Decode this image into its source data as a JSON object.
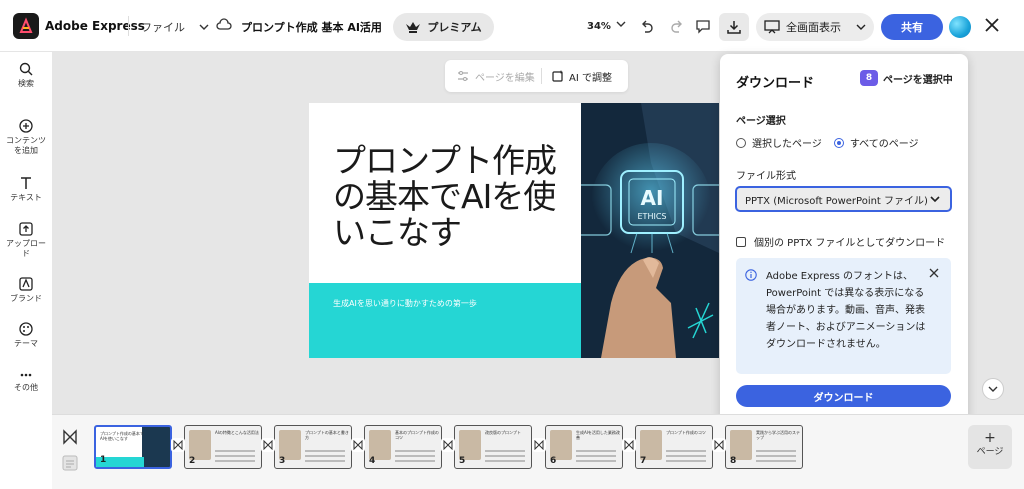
{
  "header": {
    "app_name": "Adobe Express",
    "file_menu": "ファイル",
    "doc_title": "プロンプト作成 基本 AI活用",
    "premium": "プレミアム",
    "zoom": "34%",
    "fullscreen": "全画面表示",
    "share": "共有"
  },
  "sidebar": {
    "items": [
      {
        "label": "検索",
        "icon": "search-icon"
      },
      {
        "label": "コンテンツ\nを追加",
        "icon": "plus-circle-icon"
      },
      {
        "label": "テキスト",
        "icon": "text-icon"
      },
      {
        "label": "アップロー\nド",
        "icon": "upload-icon"
      },
      {
        "label": "ブランド",
        "icon": "brand-icon"
      },
      {
        "label": "テーマ",
        "icon": "palette-icon"
      },
      {
        "label": "その他",
        "icon": "more-icon"
      }
    ]
  },
  "page_toolbar": {
    "edit_page": "ページを編集",
    "ai_adjust": "AI で調整"
  },
  "slide": {
    "title": "プロンプト作成の基本でAIを使いこなす",
    "subtitle": "生成AIを思い通りに動かすための第一歩",
    "photo_text_main": "AI",
    "photo_text_sub": "ETHICS"
  },
  "download_panel": {
    "title": "ダウンロード",
    "page_count": "8",
    "page_count_label": "ページを選択中",
    "page_select_label": "ページ選択",
    "option_selected": "選択したページ",
    "option_all": "すべてのページ",
    "file_format_label": "ファイル形式",
    "file_format_value": "PPTX (Microsoft PowerPoint ファイル)",
    "separate_files": "個別の PPTX ファイルとしてダウンロード",
    "info_text": "Adobe Express のフォントは、PowerPoint では異なる表示になる場合があります。動画、音声、発表者ノート、およびアニメーションはダウンロードされません。",
    "download_button": "ダウンロード"
  },
  "pages": [
    {
      "num": "1",
      "title": "プロンプト作成の基本でAIを使いこなす"
    },
    {
      "num": "2",
      "title": "AIの特徴とこんな活用法"
    },
    {
      "num": "3",
      "title": "プロンプトの基本と書き方"
    },
    {
      "num": "4",
      "title": "基本のプロンプト作成のコツ"
    },
    {
      "num": "5",
      "title": "改良版のプロンプト"
    },
    {
      "num": "6",
      "title": "生成AIを活用した業務改善"
    },
    {
      "num": "7",
      "title": "プロンプト作成のコツ"
    },
    {
      "num": "8",
      "title": "実践から学ぶ活用のステップ"
    }
  ],
  "add_page": "ページ"
}
